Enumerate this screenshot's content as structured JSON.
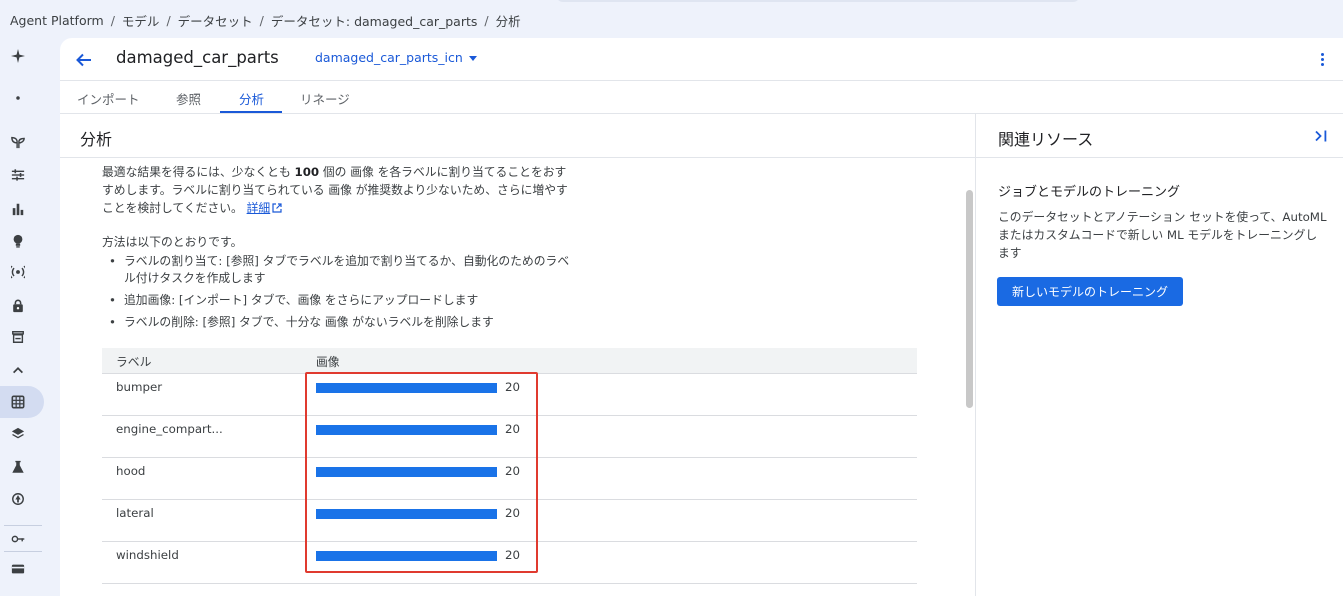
{
  "breadcrumb": {
    "items": [
      "Agent Platform",
      "モデル",
      "データセット",
      "データセット: damaged_car_parts",
      "分析"
    ],
    "separator": "/"
  },
  "header": {
    "title": "damaged_car_parts",
    "version": "damaged_car_parts_icn"
  },
  "tabs": [
    {
      "label": "インポート"
    },
    {
      "label": "参照"
    },
    {
      "label": "分析",
      "active": true
    },
    {
      "label": "リネージ"
    }
  ],
  "analysis": {
    "title": "分析",
    "intro_part1": "最適な結果を得るには、少なくとも ",
    "intro_count": "100",
    "intro_part2": " 個の 画像 を各ラベルに割り当てることをおすすめします。ラベルに割り当てられている 画像 が推奨数より少ないため、さらに増やすことを検討してください。",
    "learn_more": "詳細",
    "methods_lead": "方法は以下のとおりです。",
    "methods": [
      "ラベルの割り当て: [参照] タブでラベルを追加で割り当てるか、自動化のためのラベル付けタスクを作成します",
      "追加画像: [インポート] タブで、画像 をさらにアップロードします",
      "ラベルの削除: [参照] タブで、十分な 画像 がないラベルを削除します"
    ],
    "table": {
      "headers": {
        "label": "ラベル",
        "images": "画像"
      },
      "rows": [
        {
          "label": "bumper",
          "count": "20",
          "value": 20
        },
        {
          "label": "engine_compart...",
          "count": "20",
          "value": 20
        },
        {
          "label": "hood",
          "count": "20",
          "value": 20
        },
        {
          "label": "lateral",
          "count": "20",
          "value": 20
        },
        {
          "label": "windshield",
          "count": "20",
          "value": 20
        }
      ],
      "max_value": 20
    }
  },
  "related": {
    "title": "関連リソース",
    "subtitle": "ジョブとモデルのトレーニング",
    "description": "このデータセットとアノテーション セットを使って、AutoML またはカスタムコードで新しい ML モデルをトレーニングします",
    "button": "新しいモデルのトレーニング"
  },
  "colors": {
    "accent": "#1a59d8",
    "bar": "#1a73e8",
    "highlight": "#e03a2f"
  },
  "rail_icons": [
    "sparkle-icon",
    "dot-icon",
    "sprout-icon",
    "tune-icon",
    "bar-chart-icon",
    "lightbulb-icon",
    "broadcast-icon",
    "lock-icon",
    "storefront-icon",
    "chevron-up-icon",
    "dataset-icon",
    "layers-icon",
    "flask-icon",
    "deploy-icon",
    "key-icon",
    "card-icon"
  ]
}
